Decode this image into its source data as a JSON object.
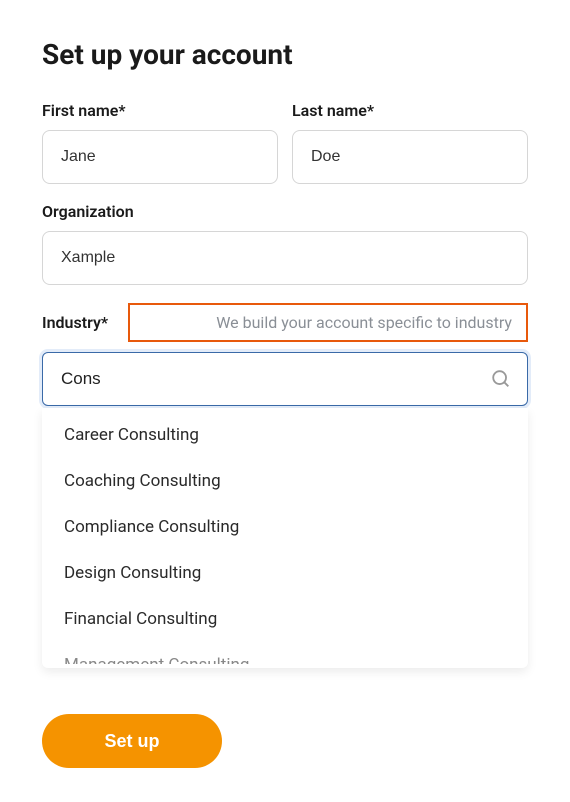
{
  "title": "Set up your account",
  "first_name": {
    "label": "First name*",
    "value": "Jane"
  },
  "last_name": {
    "label": "Last name*",
    "value": "Doe"
  },
  "organization": {
    "label": "Organization",
    "value": "Xample"
  },
  "industry": {
    "label": "Industry*",
    "helper": "We build your account specific to industry",
    "search_value": "Cons",
    "options": [
      "Career Consulting",
      "Coaching Consulting",
      "Compliance Consulting",
      "Design Consulting",
      "Financial Consulting",
      "Management Consulting"
    ]
  },
  "submit_label": "Set up"
}
